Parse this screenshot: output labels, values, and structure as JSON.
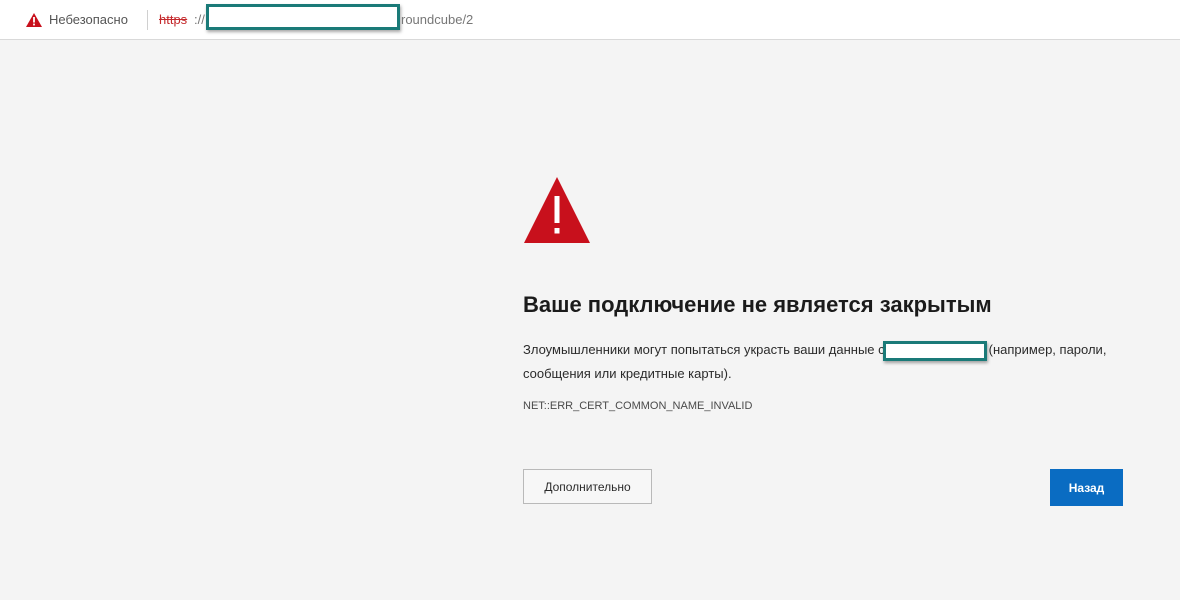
{
  "address_bar": {
    "security_label": "Небезопасно",
    "url_scheme": "https",
    "url_separator": "://",
    "url_rest": "roundcube/2"
  },
  "error_page": {
    "title": "Ваше подключение не является закрытым",
    "description_before": "Злоумышленники могут попытаться украсть ваши данные с",
    "description_after": "(например, пароли, сообщения или кредитные карты).",
    "error_code": "NET::ERR_CERT_COMMON_NAME_INVALID",
    "advanced_button": "Дополнительно",
    "back_button": "Назад"
  },
  "colors": {
    "warning_red": "#c8101c",
    "scheme_red": "#c4282b",
    "primary_blue": "#0a6cc2",
    "redaction_border": "#1a7a78"
  },
  "icons": {
    "small_warning": "warning-triangle-icon",
    "large_warning": "warning-triangle-icon"
  }
}
